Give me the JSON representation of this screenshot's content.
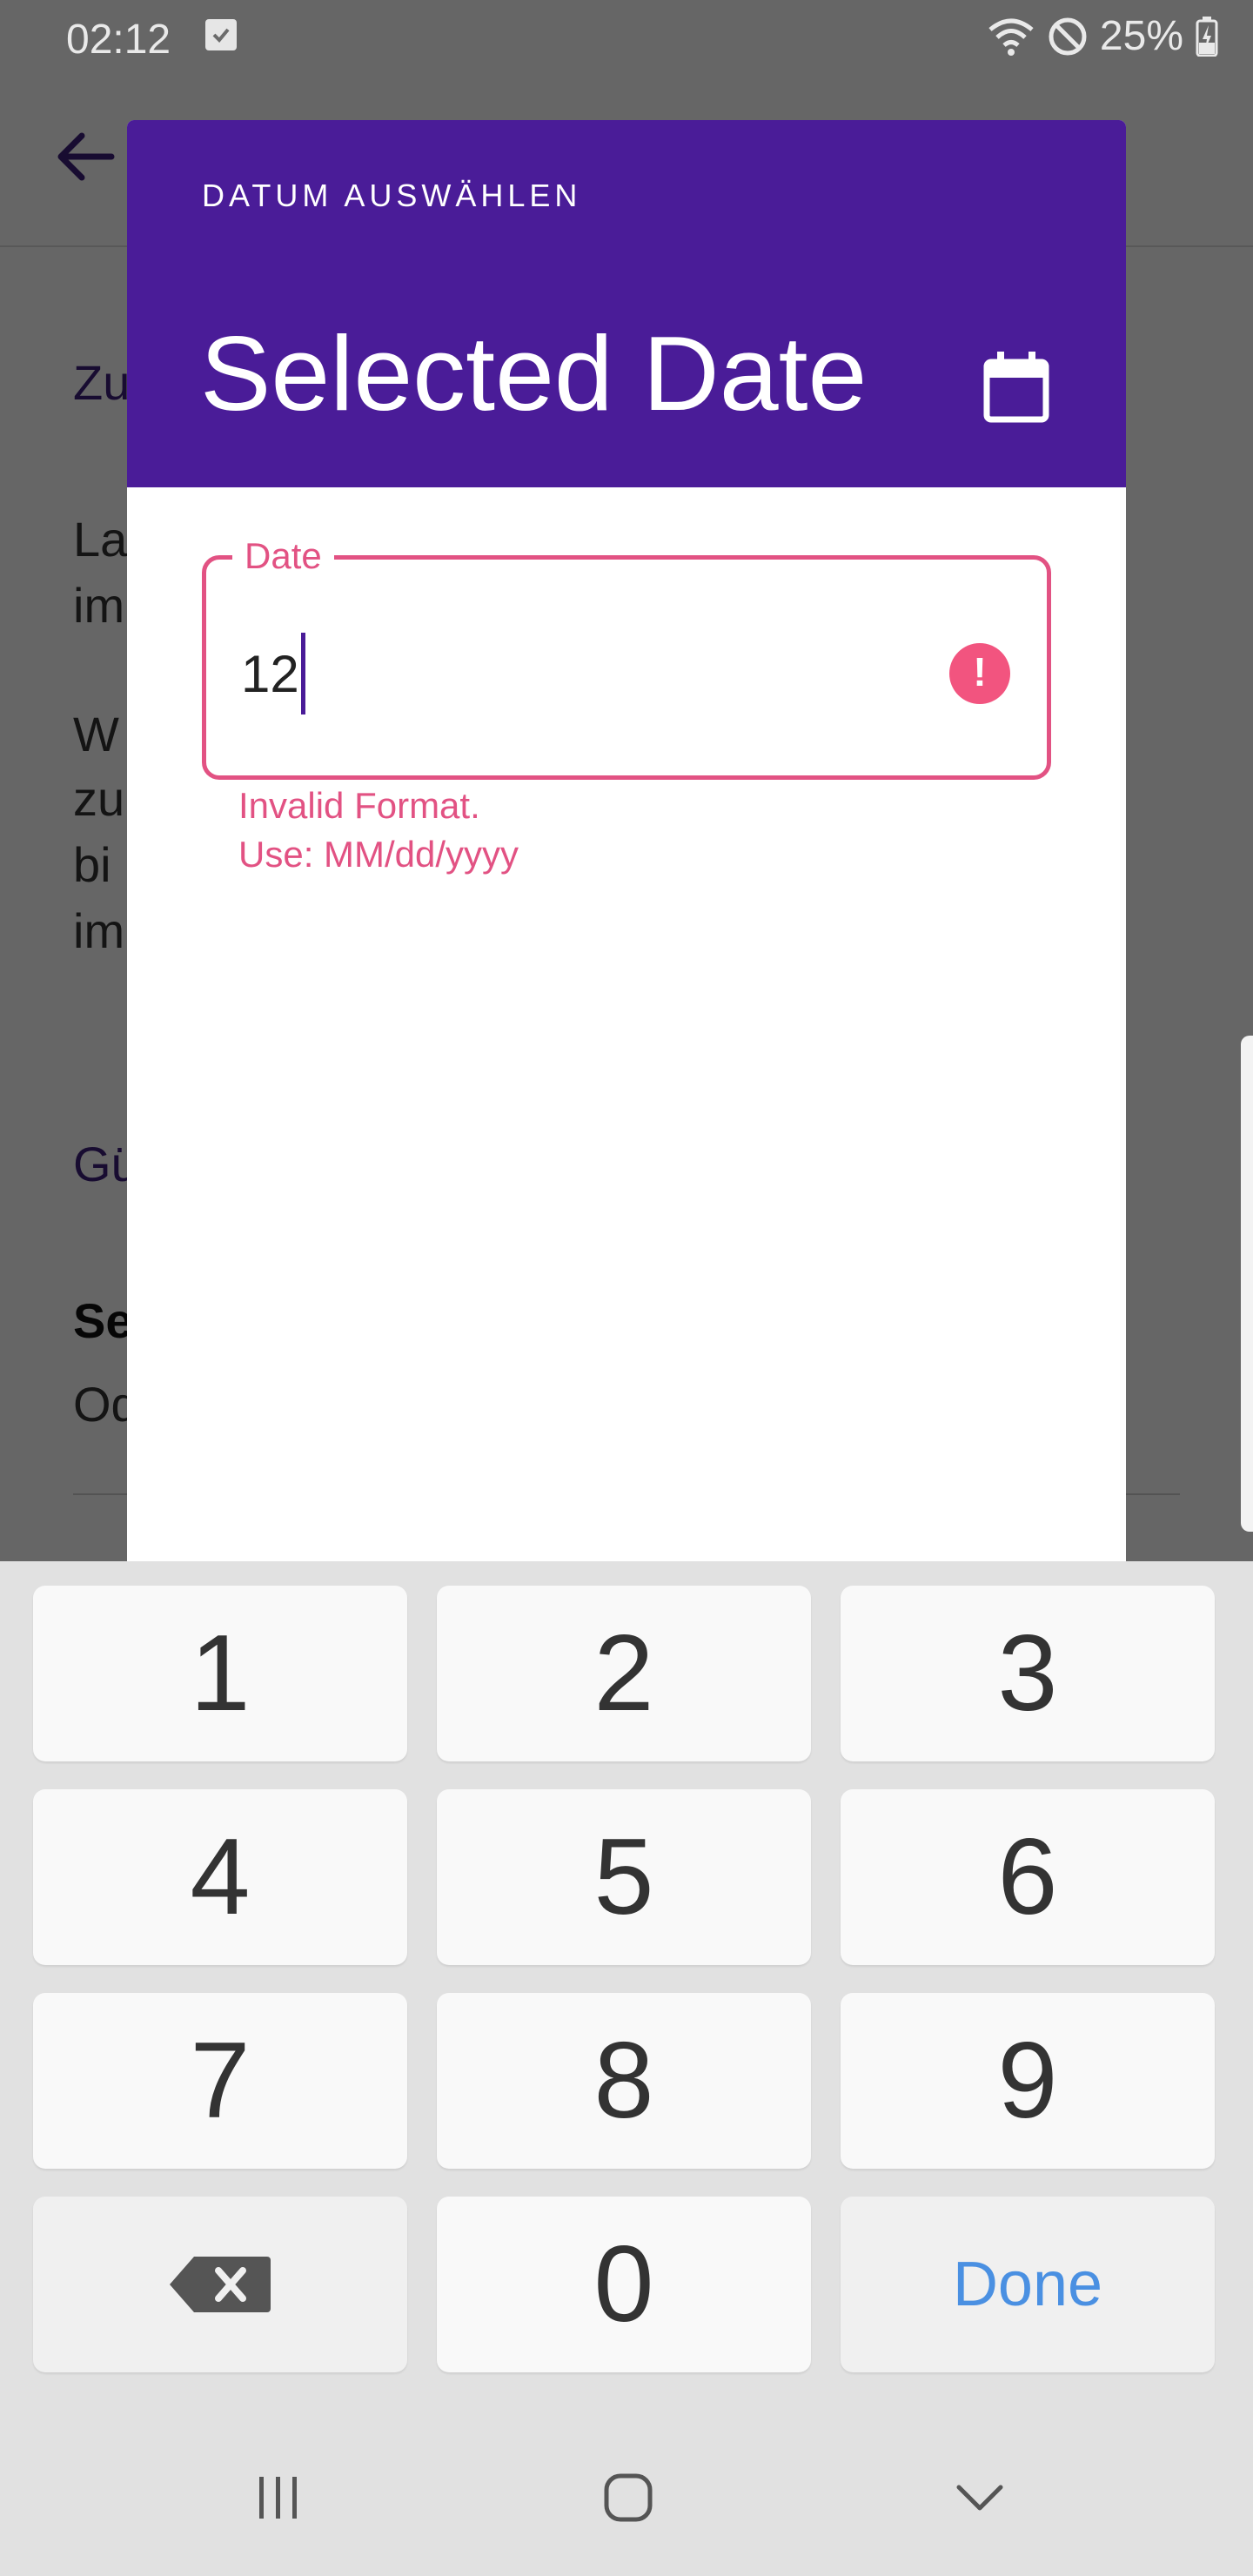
{
  "status_bar": {
    "time": "02:12",
    "battery": "25%"
  },
  "background_page": {
    "lines": [
      "Zu",
      "La",
      "im",
      "W",
      "zu",
      "bi",
      "im",
      "Gü",
      "Se",
      "Od"
    ]
  },
  "dialog": {
    "header_label": "DATUM AUSWÄHLEN",
    "title": "Selected Date",
    "field_label": "Date",
    "field_value": "12",
    "error_line1": "Invalid Format.",
    "error_line2": "Use: MM/dd/yyyy"
  },
  "keyboard": {
    "keys": [
      "1",
      "2",
      "3",
      "4",
      "5",
      "6",
      "7",
      "8",
      "9",
      "0"
    ],
    "done": "Done"
  },
  "colors": {
    "header": "#4a1c98",
    "error": "#e25283",
    "done": "#4a90e2"
  }
}
